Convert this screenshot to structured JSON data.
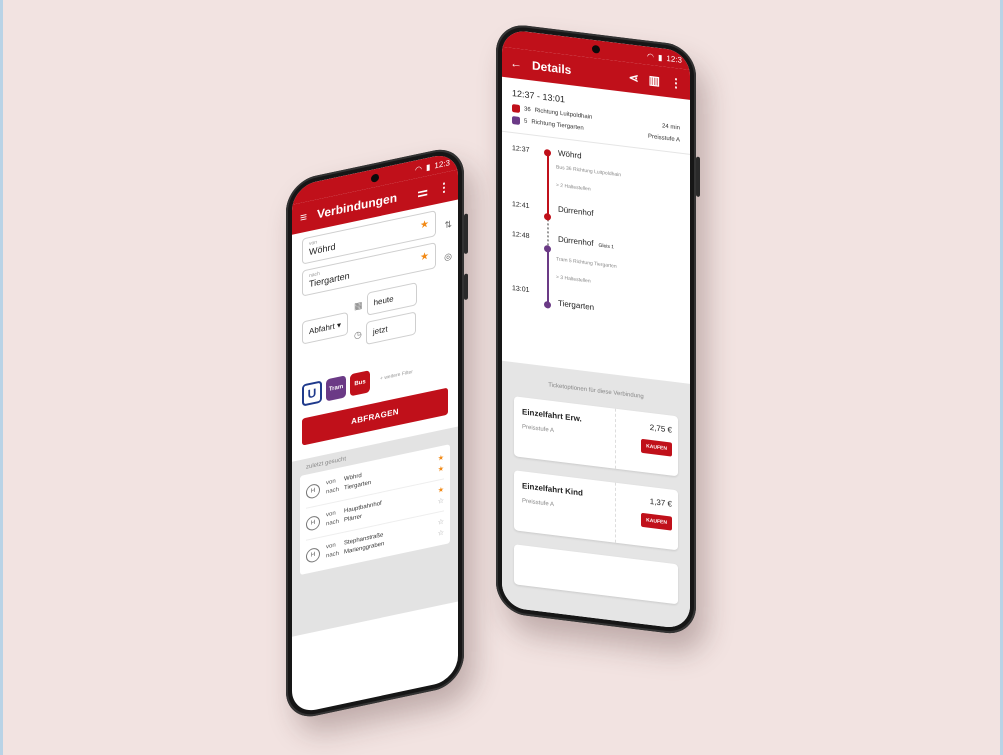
{
  "left_phone": {
    "status_time": "12:3",
    "appbar": {
      "title": "Verbindungen",
      "menu_icon": "hamburger-icon",
      "filter_icon": "sliders-icon",
      "more_icon": "kebab-icon"
    },
    "search": {
      "from_label": "von",
      "from_value": "Wöhrd",
      "to_label": "nach",
      "to_value": "Tiergarten",
      "mode_select": "Abfahrt",
      "date": "heute",
      "time": "jetzt"
    },
    "modes": [
      {
        "label": "U",
        "color": "#1f3a8c"
      },
      {
        "label": "Tram",
        "color": "#6b3a86"
      },
      {
        "label": "Bus",
        "color": "#c0101a"
      }
    ],
    "more_filters": "weitere Filter",
    "submit_label": "ABFRAGEN",
    "recent": {
      "header": "zuletzt gesucht",
      "from_word": "von",
      "to_word": "nach",
      "items": [
        {
          "from": "Wöhrd",
          "to": "Tiergarten",
          "fav_from": true,
          "fav_to": true
        },
        {
          "from": "Hauptbahnhof",
          "to": "Plärrer",
          "fav_from": true,
          "fav_to": false
        },
        {
          "from": "Stephanstraße",
          "to": "Marienggraben",
          "fav_from": false,
          "fav_to": false
        }
      ]
    }
  },
  "right_phone": {
    "status_time": "12:3",
    "appbar": {
      "title": "Details",
      "back_icon": "back-arrow-icon",
      "share_icon": "share-icon",
      "map_icon": "map-icon",
      "more_icon": "kebab-icon"
    },
    "summary": {
      "time_range": "12:37 - 13:01",
      "duration": "24 min",
      "price_level": "Preisstufe A",
      "legs": [
        {
          "line": "36",
          "direction": "Richtung Luitpoldhain",
          "color": "#c0101a"
        },
        {
          "line": "5",
          "direction": "Richtung Tiergarten",
          "color": "#6b3a86"
        }
      ]
    },
    "timeline": {
      "stops": [
        {
          "time": "12:37",
          "name": "Wöhrd",
          "detail": "Bus 36 Richtung Luitpoldhain",
          "intermediate": "> 2 Haltestellen"
        },
        {
          "time": "12:41",
          "name": "Dürrenhof"
        },
        {
          "time": "12:48",
          "name": "Dürrenhof",
          "platform": "Gleis 1",
          "detail": "Tram 5 Richtung Tiergarten",
          "intermediate": "> 3 Haltestellen"
        },
        {
          "time": "13:01",
          "name": "Tiergarten"
        }
      ]
    },
    "tickets": {
      "header": "Ticketoptionen für diese Verbindung",
      "items": [
        {
          "name": "Einzelfahrt Erw.",
          "level": "Preisstufe A",
          "price": "2,75 €",
          "buy_label": "KAUFEN"
        },
        {
          "name": "Einzelfahrt Kind",
          "level": "Preisstufe A",
          "price": "1,37 €",
          "buy_label": "KAUFEN"
        }
      ]
    }
  }
}
